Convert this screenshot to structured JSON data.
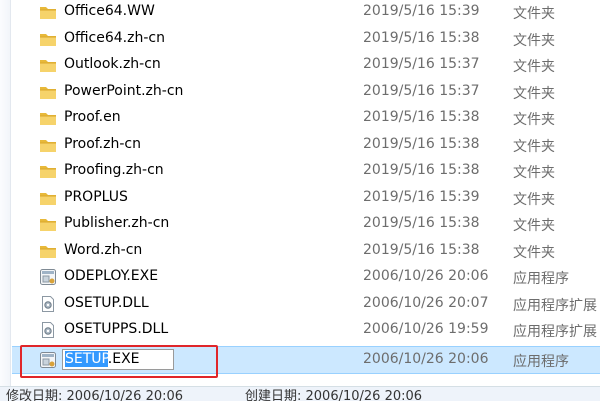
{
  "files": [
    {
      "name": "Office64.WW",
      "date": "2019/5/16 15:39",
      "type": "文件夹",
      "icon": "folder-icon"
    },
    {
      "name": "Office64.zh-cn",
      "date": "2019/5/16 15:38",
      "type": "文件夹",
      "icon": "folder-icon"
    },
    {
      "name": "Outlook.zh-cn",
      "date": "2019/5/16 15:37",
      "type": "文件夹",
      "icon": "folder-icon"
    },
    {
      "name": "PowerPoint.zh-cn",
      "date": "2019/5/16 15:37",
      "type": "文件夹",
      "icon": "folder-icon"
    },
    {
      "name": "Proof.en",
      "date": "2019/5/16 15:38",
      "type": "文件夹",
      "icon": "folder-icon"
    },
    {
      "name": "Proof.zh-cn",
      "date": "2019/5/16 15:38",
      "type": "文件夹",
      "icon": "folder-icon"
    },
    {
      "name": "Proofing.zh-cn",
      "date": "2019/5/16 15:38",
      "type": "文件夹",
      "icon": "folder-icon"
    },
    {
      "name": "PROPLUS",
      "date": "2019/5/16 15:39",
      "type": "文件夹",
      "icon": "folder-icon"
    },
    {
      "name": "Publisher.zh-cn",
      "date": "2019/5/16 15:38",
      "type": "文件夹",
      "icon": "folder-icon"
    },
    {
      "name": "Word.zh-cn",
      "date": "2019/5/16 15:38",
      "type": "文件夹",
      "icon": "folder-icon"
    },
    {
      "name": "ODEPLOY.EXE",
      "date": "2006/10/26 20:06",
      "type": "应用程序",
      "icon": "exe-icon"
    },
    {
      "name": "OSETUP.DLL",
      "date": "2006/10/26 20:07",
      "type": "应用程序扩展",
      "icon": "dll-icon"
    },
    {
      "name": "OSETUPPS.DLL",
      "date": "2006/10/26 19:59",
      "type": "应用程序扩展",
      "icon": "dll-icon"
    }
  ],
  "selected": {
    "name_highlighted": "SETUP",
    "name_rest": ".EXE",
    "date": "2006/10/26 20:06",
    "type": "应用程序",
    "icon": "exe-icon"
  },
  "status": {
    "modified": "修改日期: 2006/10/26 20:06",
    "created": "创建日期: 2006/10/26 20:06"
  },
  "colors": {
    "selection": "#cce8ff",
    "highlight": "#3399ff",
    "annotation_frame": "#e0262a"
  }
}
